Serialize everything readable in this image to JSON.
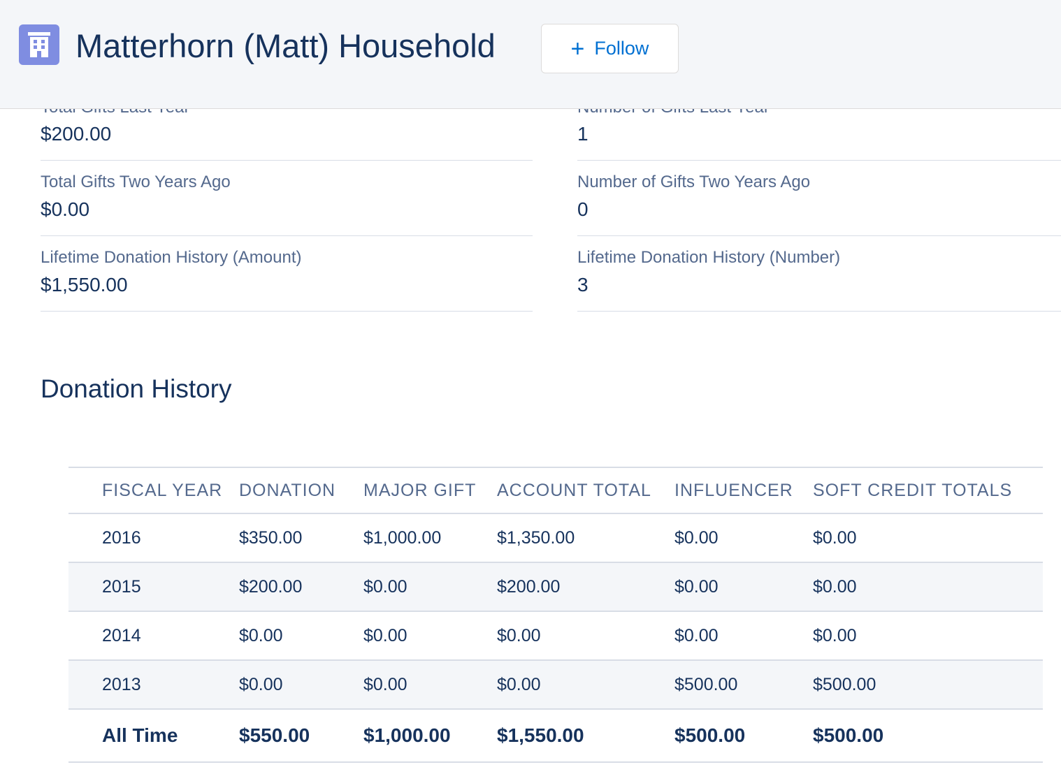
{
  "header": {
    "title": "Matterhorn (Matt) Household",
    "icon": "household-building-icon",
    "follow_icon": "plus-icon",
    "follow_label": "Follow",
    "accent_color": "#0070d2",
    "icon_color": "#7f8de1"
  },
  "fields": {
    "total_gifts_last_year": {
      "label": "Total Gifts Last Year",
      "value": "$200.00"
    },
    "number_gifts_last_year": {
      "label": "Number of Gifts Last Year",
      "value": "1"
    },
    "total_gifts_two_years_ago": {
      "label": "Total Gifts Two Years Ago",
      "value": "$0.00"
    },
    "number_gifts_two_years_ago": {
      "label": "Number of Gifts Two Years Ago",
      "value": "0"
    },
    "lifetime_amount": {
      "label": "Lifetime Donation History (Amount)",
      "value": "$1,550.00"
    },
    "lifetime_number": {
      "label": "Lifetime Donation History (Number)",
      "value": "3"
    }
  },
  "donation_history": {
    "title": "Donation History",
    "columns": [
      "FISCAL YEAR",
      "DONATION",
      "MAJOR GIFT",
      "ACCOUNT TOTAL",
      "INFLUENCER",
      "SOFT CREDIT TOTALS"
    ],
    "rows": [
      [
        "2016",
        "$350.00",
        "$1,000.00",
        "$1,350.00",
        "$0.00",
        "$0.00"
      ],
      [
        "2015",
        "$200.00",
        "$0.00",
        "$200.00",
        "$0.00",
        "$0.00"
      ],
      [
        "2014",
        "$0.00",
        "$0.00",
        "$0.00",
        "$0.00",
        "$0.00"
      ],
      [
        "2013",
        "$0.00",
        "$0.00",
        "$0.00",
        "$500.00",
        "$500.00"
      ]
    ],
    "total_row": [
      "All Time",
      "$550.00",
      "$1,000.00",
      "$1,550.00",
      "$500.00",
      "$500.00"
    ]
  }
}
